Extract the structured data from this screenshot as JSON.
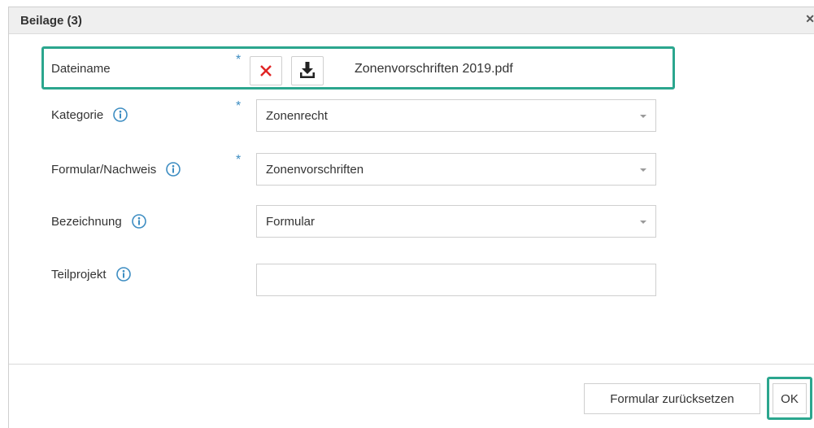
{
  "dialog": {
    "title": "Beilage (3)",
    "close_icon": "close-icon"
  },
  "fields": {
    "dateiname": {
      "label": "Dateiname",
      "file_name": "Zonenvorschriften 2019.pdf",
      "required_mark": "*"
    },
    "kategorie": {
      "label": "Kategorie",
      "value": "Zonenrecht",
      "required_mark": "*"
    },
    "formular": {
      "label": "Formular/Nachweis",
      "value": "Zonenvorschriften",
      "required_mark": "*"
    },
    "bezeichnung": {
      "label": "Bezeichnung",
      "value": "Formular"
    },
    "teilprojekt": {
      "label": "Teilprojekt",
      "value": ""
    }
  },
  "buttons": {
    "reset_label": "Formular zurücksetzen",
    "ok_label": "OK"
  },
  "colors": {
    "accent_highlight": "#2ba68e",
    "info_icon": "#3d8dc2",
    "delete_icon": "#e02424"
  }
}
